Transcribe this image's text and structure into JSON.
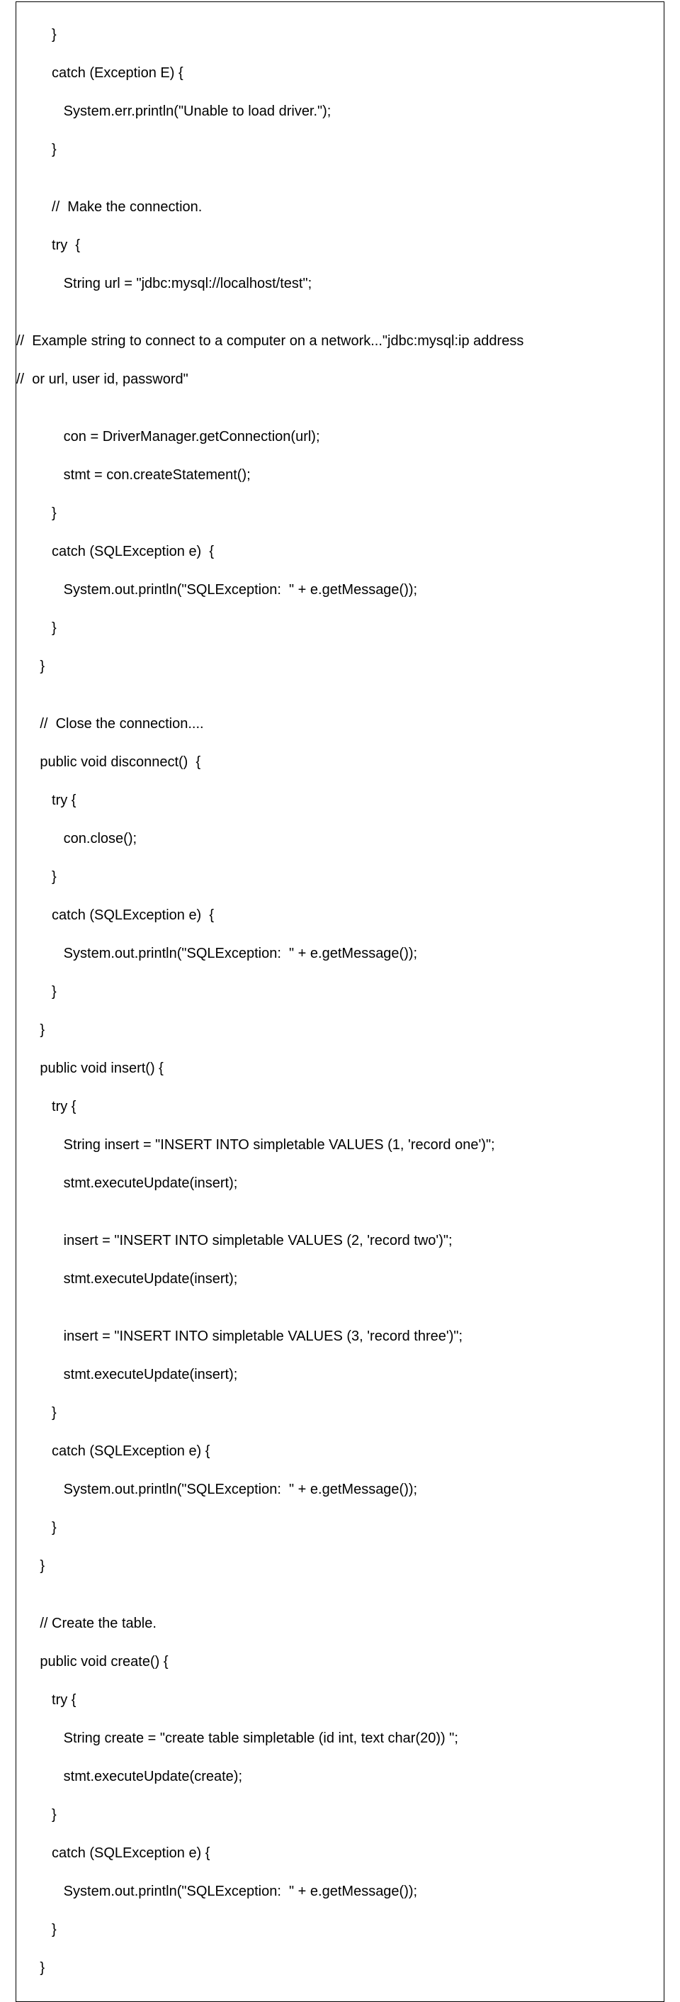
{
  "code": {
    "lines": [
      "         }",
      "         catch (Exception E) {",
      "            System.err.println(\"Unable to load driver.\");",
      "         }",
      "",
      "         //  Make the connection.",
      "         try  {",
      "            String url = \"jdbc:mysql://localhost/test\";",
      "",
      "//  Example string to connect to a computer on a network...\"jdbc:mysql:ip address",
      "//  or url, user id, password\"",
      "",
      "            con = DriverManager.getConnection(url);",
      "            stmt = con.createStatement();",
      "         }",
      "         catch (SQLException e)  {",
      "            System.out.println(\"SQLException:  \" + e.getMessage());",
      "         }",
      "      }",
      "",
      "      //  Close the connection....",
      "      public void disconnect()  {",
      "         try {",
      "            con.close();",
      "         }",
      "         catch (SQLException e)  {",
      "            System.out.println(\"SQLException:  \" + e.getMessage());",
      "         }",
      "      }",
      "      public void insert() {",
      "         try {",
      "            String insert = \"INSERT INTO simpletable VALUES (1, 'record one')\";",
      "            stmt.executeUpdate(insert);",
      "",
      "            insert = \"INSERT INTO simpletable VALUES (2, 'record two')\";",
      "            stmt.executeUpdate(insert);",
      "",
      "            insert = \"INSERT INTO simpletable VALUES (3, 'record three')\";",
      "            stmt.executeUpdate(insert);",
      "         }",
      "         catch (SQLException e) {",
      "            System.out.println(\"SQLException:  \" + e.getMessage());",
      "         }",
      "      }",
      "",
      "      // Create the table.",
      "      public void create() {",
      "         try {",
      "            String create = \"create table simpletable (id int, text char(20)) \";",
      "            stmt.executeUpdate(create);",
      "         }",
      "         catch (SQLException e) {",
      "            System.out.println(\"SQLException:  \" + e.getMessage());",
      "         }",
      "      }"
    ]
  }
}
